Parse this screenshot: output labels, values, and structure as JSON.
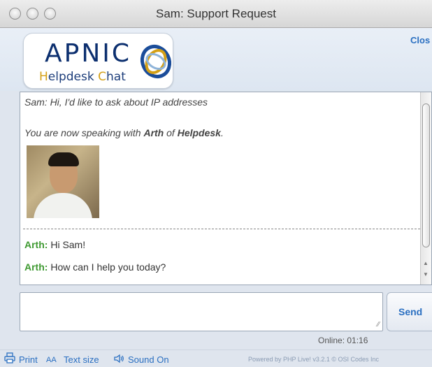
{
  "window": {
    "title": "Sam: Support Request"
  },
  "header": {
    "logo_main": "APNIC",
    "logo_sub_h": "H",
    "logo_sub_mid": "elpdesk ",
    "logo_sub_c": "C",
    "logo_sub_end": "hat",
    "close_label": "Clos"
  },
  "transcript": {
    "user_message": "Sam: Hi, I'd like to ask about IP addresses",
    "notice_prefix": "You are now speaking with ",
    "notice_agent": "Arth",
    "notice_mid": " of ",
    "notice_dept": "Helpdesk",
    "notice_end": ".",
    "messages": [
      {
        "sender": "Arth:",
        "text": " Hi Sam!"
      },
      {
        "sender": "Arth:",
        "text": " How can I help you today?"
      }
    ]
  },
  "composer": {
    "value": "",
    "send_label": "Send"
  },
  "status": {
    "online": "Online: 01:16"
  },
  "footer": {
    "print_label": "Print",
    "textsize_icon_text": "AA",
    "textsize_label": "Text size",
    "sound_label": "Sound On",
    "powered_by": "Powered by PHP Live! v3.2.1 © OSI Codes Inc"
  },
  "colors": {
    "link_blue": "#2a6fc1",
    "agent_green": "#3f9a32",
    "brand_navy": "#0c2f6f",
    "brand_gold": "#d4a017"
  }
}
